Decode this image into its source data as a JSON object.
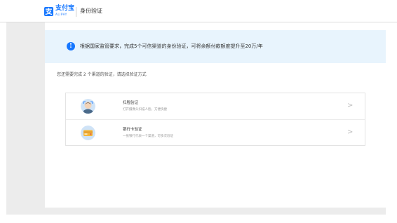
{
  "header": {
    "logo_text": "支付宝",
    "logo_sub": "ALIPAY",
    "page_title": "身份验证"
  },
  "notice": {
    "icon_char": "!",
    "text": "根据国家监管要求，完成5个可信渠道的身份验证，可将余额付款额度提升至20万/年"
  },
  "instruction": "您还需要完成 2 个渠道的验证，请选择验证方式",
  "methods": [
    {
      "title": "扫脸验证",
      "desc": "打开摄像头扫描人脸，方便快捷",
      "icon": "face-scan-icon"
    },
    {
      "title": "银行卡验证",
      "desc": "一张银行代表一个渠道，可多次验证",
      "icon": "bank-card-icon"
    }
  ],
  "chevron_char": ">",
  "colors": {
    "brand": "#1677ff",
    "notice_bg": "#e8f4fd",
    "page_bg": "#ececec"
  }
}
